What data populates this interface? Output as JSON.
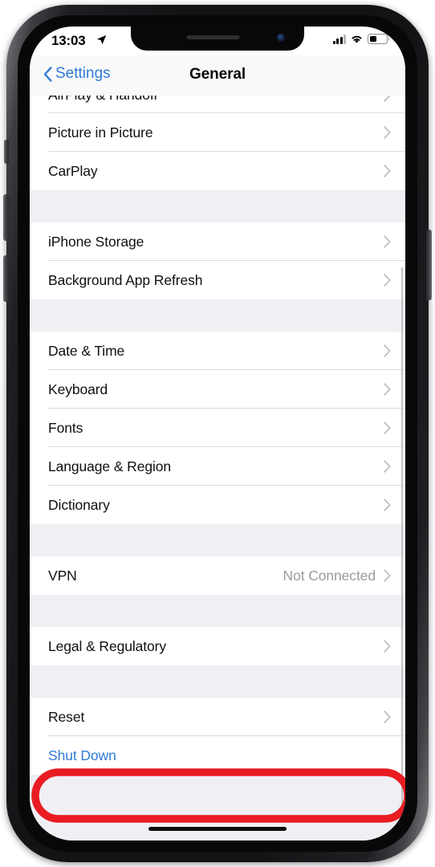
{
  "status_bar": {
    "time": "13:03",
    "location_icon": "location-arrow-icon",
    "cellular_icon": "signal-bars-icon",
    "wifi_icon": "wifi-icon",
    "battery_icon": "battery-icon",
    "battery_level_percent": 35
  },
  "nav_bar": {
    "back_label": "Settings",
    "back_icon": "chevron-left-icon",
    "title": "General"
  },
  "colors": {
    "ios_blue": "#2f7bd6",
    "annotation_red": "#e81c22",
    "group_background": "#ffffff",
    "page_background": "#efeff4",
    "value_grey": "#9a9aa0"
  },
  "annotation": {
    "shape": "ellipse",
    "target_row": "Reset",
    "color": "#e81c22",
    "stroke_width": 9
  },
  "groups": [
    {
      "id": "media",
      "rows": [
        {
          "label": "AirPlay & Handoff",
          "clipped": true,
          "accessory": "chevron"
        },
        {
          "label": "Picture in Picture",
          "accessory": "chevron"
        },
        {
          "label": "CarPlay",
          "accessory": "chevron"
        }
      ]
    },
    {
      "id": "storage",
      "rows": [
        {
          "label": "iPhone Storage",
          "accessory": "chevron"
        },
        {
          "label": "Background App Refresh",
          "accessory": "chevron"
        }
      ]
    },
    {
      "id": "locale",
      "rows": [
        {
          "label": "Date & Time",
          "accessory": "chevron"
        },
        {
          "label": "Keyboard",
          "accessory": "chevron"
        },
        {
          "label": "Fonts",
          "accessory": "chevron"
        },
        {
          "label": "Language & Region",
          "accessory": "chevron"
        },
        {
          "label": "Dictionary",
          "accessory": "chevron"
        }
      ]
    },
    {
      "id": "network",
      "rows": [
        {
          "label": "VPN",
          "value": "Not Connected",
          "accessory": "chevron"
        }
      ]
    },
    {
      "id": "legal",
      "rows": [
        {
          "label": "Legal & Regulatory",
          "accessory": "chevron"
        }
      ]
    },
    {
      "id": "reset",
      "rows": [
        {
          "label": "Reset",
          "accessory": "chevron",
          "highlighted": true
        },
        {
          "label": "Shut Down",
          "style": "link"
        }
      ]
    }
  ],
  "home_indicator": "home-indicator"
}
